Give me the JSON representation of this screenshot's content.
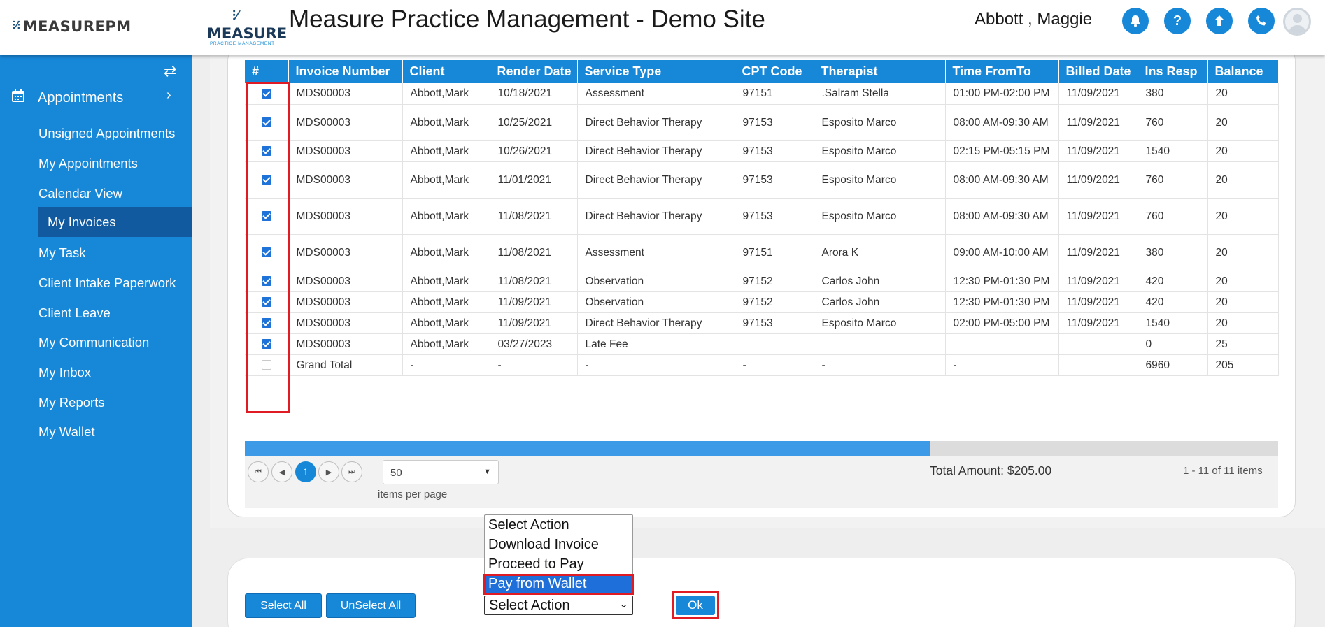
{
  "app": {
    "brand_logo_text": "MEASUREPM",
    "brand2_word": "MEASURE",
    "brand2_sub": "PRACTICE MANAGEMENT",
    "title": "Measure Practice Management - Demo Site",
    "user_name": "Abbott , Maggie"
  },
  "header_icons": [
    "bell-icon",
    "help-icon",
    "upload-icon",
    "phone-icon",
    "user-avatar-icon"
  ],
  "sidebar": {
    "section_label": "Appointments",
    "items": [
      {
        "label": "Unsigned Appointments",
        "active": false
      },
      {
        "label": "My Appointments",
        "active": false
      },
      {
        "label": "Calendar View",
        "active": false
      },
      {
        "label": "My Invoices",
        "active": true
      },
      {
        "label": "My Task",
        "active": false
      },
      {
        "label": "Client Intake Paperwork",
        "active": false
      },
      {
        "label": "Client Leave",
        "active": false
      },
      {
        "label": "My Communication",
        "active": false
      },
      {
        "label": "My Inbox",
        "active": false
      },
      {
        "label": "My Reports",
        "active": false
      },
      {
        "label": "My Wallet",
        "active": false
      }
    ]
  },
  "table": {
    "columns": [
      "#",
      "Invoice Number",
      "Client",
      "Render Date",
      "Service Type",
      "CPT Code",
      "Therapist",
      "Time FromTo",
      "Billed Date",
      "Ins Resp",
      "Balance"
    ],
    "rows": [
      {
        "checked": true,
        "invoice": "MDS00003",
        "client": "Abbott,Mark",
        "render": "10/18/2021",
        "service": "Assessment",
        "cpt": "97151",
        "therapist": ".Salram Stella",
        "time": "01:00 PM-02:00 PM",
        "billed": "11/09/2021",
        "ins": "380",
        "balance": "20"
      },
      {
        "checked": true,
        "invoice": "MDS00003",
        "client": "Abbott,Mark",
        "render": "10/25/2021",
        "service": "Direct Behavior Therapy",
        "cpt": "97153",
        "therapist": "Esposito Marco",
        "time": "08:00 AM-09:30 AM",
        "billed": "11/09/2021",
        "ins": "760",
        "balance": "20"
      },
      {
        "checked": true,
        "invoice": "MDS00003",
        "client": "Abbott,Mark",
        "render": "10/26/2021",
        "service": "Direct Behavior Therapy",
        "cpt": "97153",
        "therapist": "Esposito Marco",
        "time": "02:15 PM-05:15 PM",
        "billed": "11/09/2021",
        "ins": "1540",
        "balance": "20"
      },
      {
        "checked": true,
        "invoice": "MDS00003",
        "client": "Abbott,Mark",
        "render": "11/01/2021",
        "service": "Direct Behavior Therapy",
        "cpt": "97153",
        "therapist": "Esposito Marco",
        "time": "08:00 AM-09:30 AM",
        "billed": "11/09/2021",
        "ins": "760",
        "balance": "20"
      },
      {
        "checked": true,
        "invoice": "MDS00003",
        "client": "Abbott,Mark",
        "render": "11/08/2021",
        "service": "Direct Behavior Therapy",
        "cpt": "97153",
        "therapist": "Esposito Marco",
        "time": "08:00 AM-09:30 AM",
        "billed": "11/09/2021",
        "ins": "760",
        "balance": "20"
      },
      {
        "checked": true,
        "invoice": "MDS00003",
        "client": "Abbott,Mark",
        "render": "11/08/2021",
        "service": "Assessment",
        "cpt": "97151",
        "therapist": "Arora K",
        "time": "09:00 AM-10:00 AM",
        "billed": "11/09/2021",
        "ins": "380",
        "balance": "20"
      },
      {
        "checked": true,
        "invoice": "MDS00003",
        "client": "Abbott,Mark",
        "render": "11/08/2021",
        "service": "Observation",
        "cpt": "97152",
        "therapist": "Carlos John",
        "time": "12:30 PM-01:30 PM",
        "billed": "11/09/2021",
        "ins": "420",
        "balance": "20"
      },
      {
        "checked": true,
        "invoice": "MDS00003",
        "client": "Abbott,Mark",
        "render": "11/09/2021",
        "service": "Observation",
        "cpt": "97152",
        "therapist": "Carlos John",
        "time": "12:30 PM-01:30 PM",
        "billed": "11/09/2021",
        "ins": "420",
        "balance": "20"
      },
      {
        "checked": true,
        "invoice": "MDS00003",
        "client": "Abbott,Mark",
        "render": "11/09/2021",
        "service": "Direct Behavior Therapy",
        "cpt": "97153",
        "therapist": "Esposito Marco",
        "time": "02:00 PM-05:00 PM",
        "billed": "11/09/2021",
        "ins": "1540",
        "balance": "20"
      },
      {
        "checked": true,
        "invoice": "MDS00003",
        "client": "Abbott,Mark",
        "render": "03/27/2023",
        "service": "Late Fee",
        "cpt": "",
        "therapist": "",
        "time": "",
        "billed": "",
        "ins": "0",
        "balance": "25"
      },
      {
        "checked": false,
        "invoice": "Grand Total",
        "client": "-",
        "render": "-",
        "service": "-",
        "cpt": "-",
        "therapist": "-",
        "time": "-",
        "billed": "",
        "ins": "6960",
        "balance": "205"
      }
    ]
  },
  "pager": {
    "current_page": "1",
    "page_size": "50",
    "items_per_page_label": "items per page",
    "total_amount": "Total Amount: $205.00",
    "count_label": "1 - 11 of 11 items"
  },
  "actions": {
    "select_all": "Select All",
    "unselect_all": "UnSelect All",
    "select_value": "Select Action",
    "options": [
      "Select Action",
      "Download Invoice",
      "Proceed to Pay",
      "Pay from Wallet"
    ],
    "highlighted_option": "Pay from Wallet",
    "ok": "Ok"
  },
  "colors": {
    "primary": "#1787d8",
    "sidebar_active": "#115aa0",
    "highlight_red": "#e01b24"
  }
}
